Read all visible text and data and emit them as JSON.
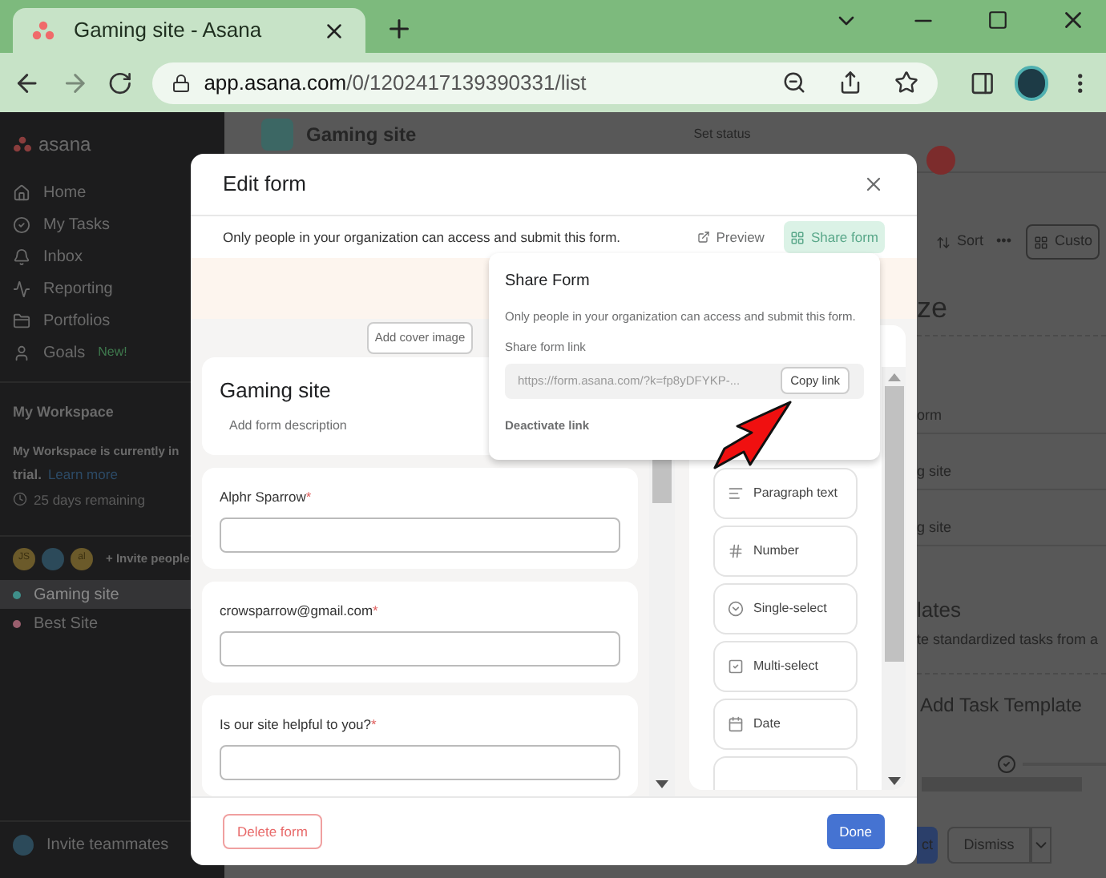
{
  "browser": {
    "tab_title": "Gaming site - Asana",
    "url_host": "app.asana.com",
    "url_path": "/0/1202417139390331/list"
  },
  "sidebar": {
    "logo": "asana",
    "nav": [
      {
        "label": "Home"
      },
      {
        "label": "My Tasks"
      },
      {
        "label": "Inbox"
      },
      {
        "label": "Reporting"
      },
      {
        "label": "Portfolios"
      },
      {
        "label": "Goals",
        "badge": "New!"
      }
    ],
    "workspace": {
      "title": "My Workspace",
      "trial_text": "My Workspace is currently in",
      "trial_end": "trial.",
      "trial_link": "Learn more",
      "days": "25 days remaining"
    },
    "members": [
      "JS",
      "al"
    ],
    "invite_people": "+ Invite people",
    "projects": [
      {
        "name": "Gaming site",
        "color": "#3f8f8a",
        "selected": true
      },
      {
        "name": "Best Site",
        "color": "#9a5f6e",
        "selected": false
      }
    ],
    "invite_teammates": "Invite teammates"
  },
  "project_header": {
    "title": "Gaming site",
    "status": "Set status"
  },
  "background": {
    "sort": "Sort",
    "more": "•••",
    "customize": "Custo",
    "heading": "ze",
    "rows": [
      "orm",
      "g site",
      "g site"
    ],
    "templates_title": "lates",
    "templates_desc": "te standardized tasks from a",
    "add_template": "Add Task Template",
    "primary": "ct",
    "dismiss": "Dismiss"
  },
  "modal": {
    "title": "Edit form",
    "notice": "Only people in your organization can access and submit this form.",
    "preview": "Preview",
    "share": "Share form",
    "cover": "Add cover image",
    "form_title": "Gaming site",
    "form_description": "Add form description",
    "required_mark": "*",
    "questions": [
      {
        "label": "Alphr Sparrow",
        "required": true
      },
      {
        "label": "crowsparrow@gmail.com",
        "required": true
      },
      {
        "label": "Is our site helpful to you?",
        "required": true
      }
    ],
    "field_types": [
      {
        "kind": "paragraph",
        "label": "Paragraph text"
      },
      {
        "kind": "number",
        "label": "Number"
      },
      {
        "kind": "single",
        "label": "Single-select"
      },
      {
        "kind": "multi",
        "label": "Multi-select"
      },
      {
        "kind": "date",
        "label": "Date"
      }
    ],
    "delete": "Delete form",
    "done": "Done"
  },
  "popover": {
    "title": "Share Form",
    "description": "Only people in your organization can access and submit this form.",
    "link_label": "Share form link",
    "link": "https://form.asana.com/?k=fp8yDFYKP-...",
    "copy": "Copy link",
    "deactivate": "Deactivate link"
  }
}
